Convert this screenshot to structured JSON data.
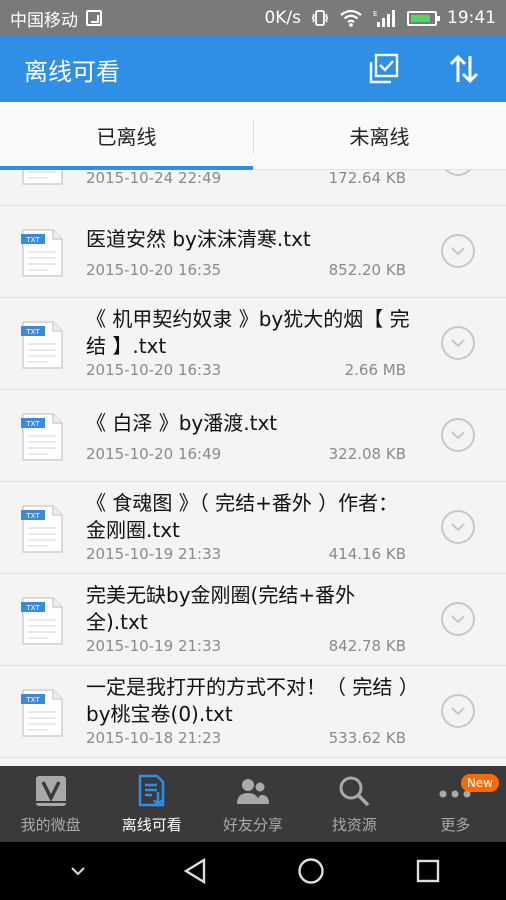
{
  "status_bar": {
    "carrier": "中国移动",
    "speed": "0K/s",
    "time": "19:41"
  },
  "app_bar": {
    "title": "离线可看"
  },
  "tabs": [
    {
      "label": "已离线",
      "active": true
    },
    {
      "label": "未离线",
      "active": false
    }
  ],
  "files": [
    {
      "name": "",
      "date": "2015-10-24 22:49",
      "size": "172.64 KB"
    },
    {
      "name": "医道安然 by沫沫清寒.txt",
      "date": "2015-10-20 16:35",
      "size": "852.20 KB"
    },
    {
      "name": "《 机甲契约奴隶 》by犹大的烟【 完结 】.txt",
      "date": "2015-10-20 16:33",
      "size": "2.66 MB"
    },
    {
      "name": "《 白泽 》by潘渡.txt",
      "date": "2015-10-20 16:49",
      "size": "322.08 KB"
    },
    {
      "name": "《 食魂图 》（ 完结+番外 ）作者：金刚圈.txt",
      "date": "2015-10-19 21:33",
      "size": "414.16 KB"
    },
    {
      "name": "完美无缺by金刚圈(完结+番外全).txt",
      "date": "2015-10-19 21:33",
      "size": "842.78 KB"
    },
    {
      "name": "一定是我打开的方式不对！（ 完结 ）by桃宝卷(0).txt",
      "date": "2015-10-18 21:23",
      "size": "533.62 KB"
    }
  ],
  "file_icon_label": "TXT",
  "bottom_nav": [
    {
      "label": "我的微盘",
      "icon": "disk-icon",
      "active": false
    },
    {
      "label": "离线可看",
      "icon": "offline-doc-icon",
      "active": true
    },
    {
      "label": "好友分享",
      "icon": "friends-icon",
      "active": false
    },
    {
      "label": "找资源",
      "icon": "search-icon",
      "active": false
    },
    {
      "label": "更多",
      "icon": "more-icon",
      "active": false,
      "badge": "New"
    }
  ],
  "colors": {
    "accent": "#2f8ee6",
    "status_bar": "#7a7a7a",
    "bottom_nav": "#3a3a3a",
    "badge": "#ff6a00"
  }
}
